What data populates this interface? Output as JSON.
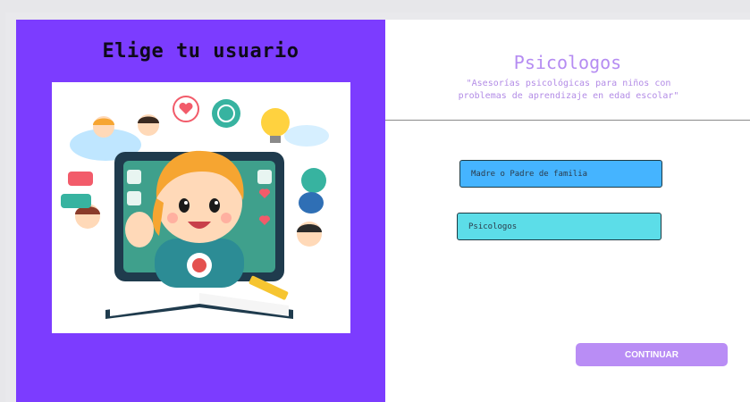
{
  "left": {
    "title": "Elige tu usuario"
  },
  "right": {
    "title": "Psicologos",
    "subtitle": "\"Asesorías psicológicas para niños con problemas de aprendizaje en edad escolar\""
  },
  "options": {
    "parent": "Madre o Padre de familia",
    "psychologist": "Psicologos"
  },
  "continue_label": "CONTINUAR",
  "colors": {
    "left_panel": "#7c3cff",
    "option_parent": "#45b4ff",
    "option_psychologist": "#5cdde8",
    "continue_button": "#b98df5",
    "title": "#b58cf2"
  }
}
